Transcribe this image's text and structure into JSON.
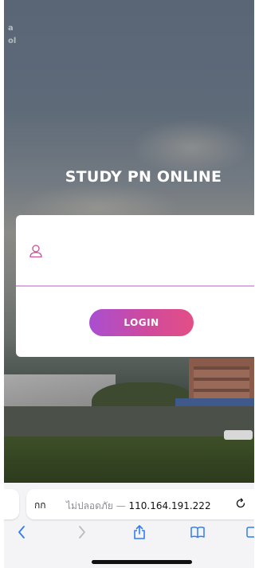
{
  "login": {
    "app_title": "STUDY PN ONLINE",
    "username_placeholder": "",
    "login_button_label": "LOGIN"
  },
  "background": {
    "corner_text_line1": "a",
    "corner_text_line2": "ol"
  },
  "browser": {
    "aa_label": "กก",
    "security_label": "ไม่ปลอดภัย",
    "separator": "—",
    "host": "110.164.191.222"
  },
  "icons": {
    "user": "user-icon",
    "reload": "reload-icon",
    "back": "chevron-left-icon",
    "forward": "chevron-right-icon",
    "share": "share-icon",
    "bookmarks": "book-icon",
    "tabs": "tabs-icon"
  },
  "colors": {
    "accent_start": "#a94fd1",
    "accent_end": "#e34f86",
    "underline": "#d7aedd",
    "ios_blue": "#2f7cf6"
  }
}
